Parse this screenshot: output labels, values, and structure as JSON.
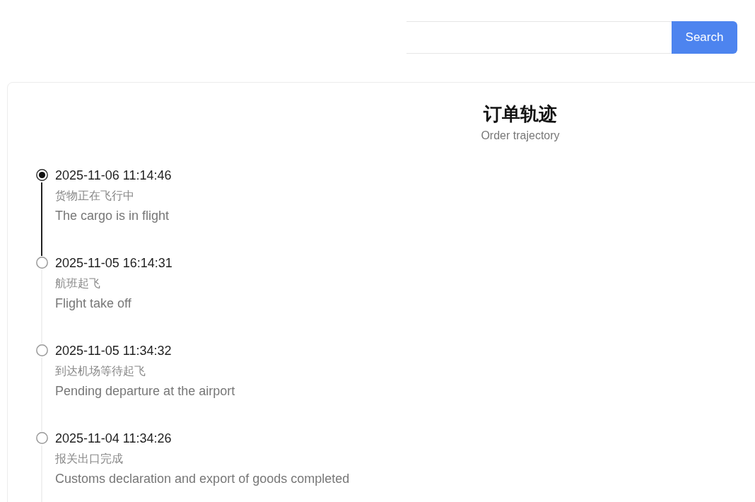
{
  "search": {
    "button": "Search"
  },
  "header": {
    "title": "订单轨迹",
    "subtitle": "Order trajectory"
  },
  "timeline": [
    {
      "time": "2025-11-06 11:14:46",
      "status_zh": "货物正在飞行中",
      "status_en": "The cargo is in flight",
      "active": true
    },
    {
      "time": "2025-11-05 16:14:31",
      "status_zh": "航班起飞",
      "status_en": "Flight take off",
      "active": false
    },
    {
      "time": "2025-11-05 11:34:32",
      "status_zh": "到达机场等待起飞",
      "status_en": "Pending departure at the airport",
      "active": false
    },
    {
      "time": "2025-11-04 11:34:26",
      "status_zh": "报关出口完成",
      "status_en": "Customs declaration and export of goods completed",
      "active": false
    }
  ]
}
